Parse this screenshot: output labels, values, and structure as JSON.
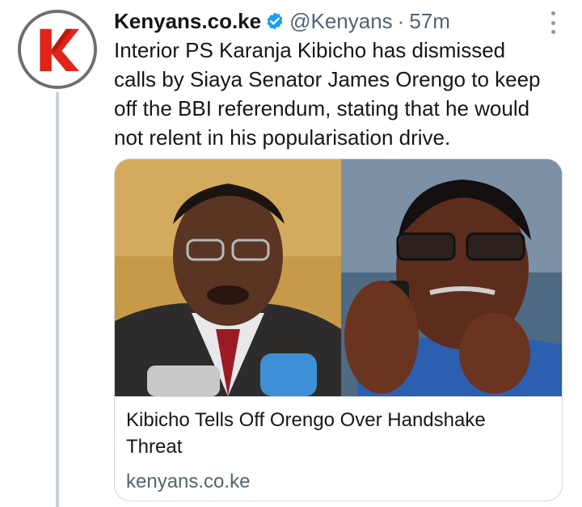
{
  "author": {
    "display_name": "Kenyans.co.ke",
    "handle": "@Kenyans",
    "separator": "·",
    "time": "57m",
    "verified": true,
    "avatar_icon": "kenyans-k-logo",
    "avatar_colors": {
      "primary": "#e2231a",
      "border": "#6e6e6e"
    }
  },
  "tweet": {
    "lines": [
      "Interior PS Karanja Kibicho has dismissed",
      "calls by Siaya Senator James Orengo to keep",
      "off the BBI referendum, stating that he would",
      "not relent in his popularisation drive."
    ]
  },
  "card": {
    "image_icon": "news-photo-two-men",
    "title_lines": [
      "Kibicho Tells Off Orengo Over Handshake",
      "Threat"
    ],
    "domain": "kenyans.co.ke"
  },
  "colors": {
    "text": "#14171a",
    "secondary": "#536471",
    "verified": "#1d9bf0",
    "border": "#cfd9de",
    "thread_line": "#c9d1d8"
  },
  "menu_icon": "more-options-icon"
}
